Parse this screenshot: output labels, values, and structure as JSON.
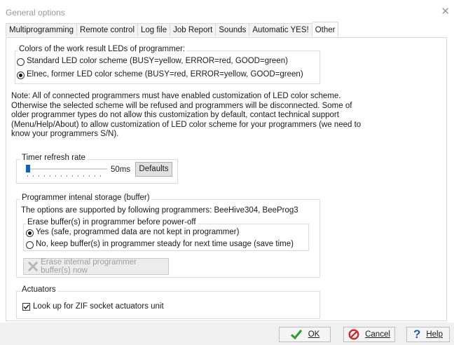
{
  "window": {
    "title": "General options"
  },
  "tabs": [
    {
      "label": "Multiprogramming"
    },
    {
      "label": "Remote control"
    },
    {
      "label": "Log file"
    },
    {
      "label": "Job Report"
    },
    {
      "label": "Sounds"
    },
    {
      "label": "Automatic YES!"
    },
    {
      "label": "Other",
      "active": true
    }
  ],
  "led_colors": {
    "legend": "Colors of the work result LEDs of programmer:",
    "options": [
      {
        "label": "Standard LED color scheme (BUSY=yellow, ERROR=red, GOOD=green)",
        "selected": false
      },
      {
        "label": "Elnec, former LED color scheme (BUSY=red, ERROR=yellow, GOOD=green)",
        "selected": true
      }
    ]
  },
  "note_lines": [
    "Note: All of connected programmers must have enabled customization of LED color scheme.",
    "Otherwise the selected scheme will be refused and programmers will be disconnected. Some of",
    "older programmer types do not allow this customization by default, contact technical support",
    "(Menu/Help/About) to allow customization of LED color scheme for your programmers (we need to",
    "know your programmers S/N)."
  ],
  "timer": {
    "legend": "Timer refresh rate",
    "value": "50ms",
    "defaults_label": "Defaults",
    "slider_fraction": 0.0
  },
  "storage": {
    "legend": "Programmer intenal storage (buffer)",
    "supported": "The options are supported by following programmers: BeeHive304, BeeProg3",
    "erase_legend": "Erase buffer(s) in programmer before power-off",
    "options": [
      {
        "label": "Yes (safe, programmed data are not kept in programmer)",
        "selected": true
      },
      {
        "label": "No, keep buffer(s) in programmer steady for next time usage (save time)",
        "selected": false
      }
    ],
    "erase_button": "Erase internal programmer buffer(s) now"
  },
  "actuators": {
    "legend": "Actuators",
    "checkbox_label": "Look up for ZIF socket actuators unit",
    "checked": true
  },
  "footer": {
    "ok": "OK",
    "cancel": "Cancel",
    "help": "Help"
  },
  "colors": {
    "ok_check": "#2a9d2a",
    "cancel_icon": "#d12828",
    "help_icon": "#2a56b8"
  }
}
